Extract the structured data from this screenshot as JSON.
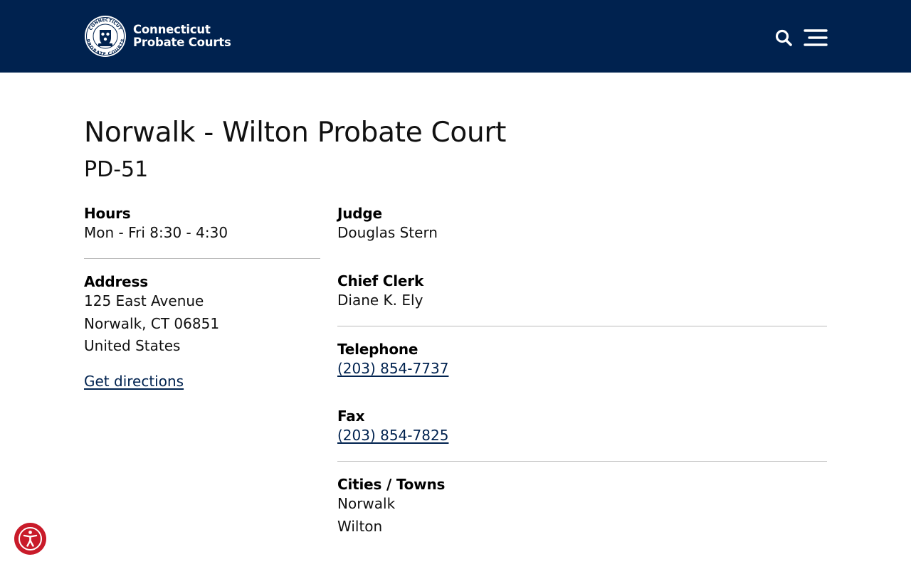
{
  "header": {
    "logo_line1": "Connecticut",
    "logo_line2": "Probate Courts",
    "logo_seal_text": "CONNECTICUT PROBATE COURTS",
    "search_icon": "search-icon",
    "menu_icon": "hamburger-menu-icon",
    "background_color": "#00224f"
  },
  "court": {
    "title": "Norwalk - Wilton Probate Court",
    "code": "PD-51"
  },
  "left": {
    "hours_label": "Hours",
    "hours_value": "Mon - Fri 8:30 - 4:30",
    "address_label": "Address",
    "address_line1": "125 East Avenue",
    "address_line2": "Norwalk, CT 06851",
    "address_line3": "United States",
    "directions_link": "Get directions"
  },
  "right": {
    "judge_label": "Judge",
    "judge_value": "Douglas Stern",
    "clerk_label": "Chief Clerk",
    "clerk_value": "Diane K. Ely",
    "telephone_label": "Telephone",
    "telephone_value": "(203) 854-7737",
    "fax_label": "Fax",
    "fax_value": "(203) 854-7825",
    "towns_label": "Cities / Towns",
    "towns": [
      "Norwalk",
      "Wilton"
    ]
  },
  "accessibility": {
    "icon": "accessibility-icon",
    "color": "#c91b2a"
  }
}
